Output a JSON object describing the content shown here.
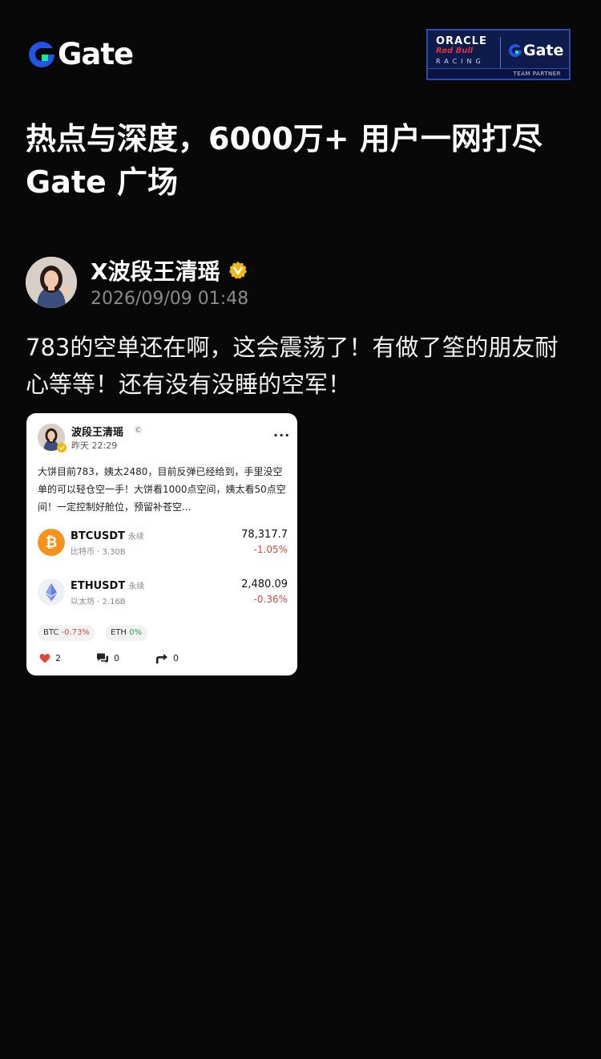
{
  "brand": {
    "name": "Gate",
    "accent": "#2354e6",
    "accent_green": "#17e6a1"
  },
  "partner": {
    "oracle": "ORACLE",
    "redbull": "Red Bull",
    "racing": "RACING",
    "gate": "Gate",
    "team_partner": "TEAM PARTNER"
  },
  "headline": "热点与深度，6000万+ 用户一网打尽\nGate 广场",
  "author": {
    "name": "X波段王清瑶",
    "time": "2026/09/09 01:48",
    "verified_icon": "verified-icon",
    "verified_color": "#f0b90b"
  },
  "post": {
    "text": "783的空单还在啊，这会震荡了！有做了筌的朋友耐心等等！还有没有没睡的空军！"
  },
  "quoted": {
    "name": "波段王清瑶",
    "time": "昨天 22:29",
    "more": "···",
    "text": "大饼目前783，姨太2480，目前反弹已经给到，手里没空单的可以轻仓空一手！大饼看1000点空间，姨太看50点空间！一定控制好舱位，预留补苍空...",
    "tickers": [
      {
        "symbol": "BTCUSDT",
        "type": "永续",
        "sub": "比特币 · 3.30B",
        "price": "78,317.7",
        "change": "-1.05%",
        "icon": "bitcoin-icon",
        "color": "#f7931a"
      },
      {
        "symbol": "ETHUSDT",
        "type": "永续",
        "sub": "以太坊 · 2.16B",
        "price": "2,480.09",
        "change": "-0.36%",
        "icon": "ethereum-icon",
        "color": "#627eea"
      }
    ],
    "chips": [
      {
        "label": "BTC",
        "value": "-0.73%"
      },
      {
        "label": "ETH",
        "value": "0%"
      }
    ],
    "actions": {
      "likes": "2",
      "comments": "0",
      "shares": "0"
    }
  }
}
